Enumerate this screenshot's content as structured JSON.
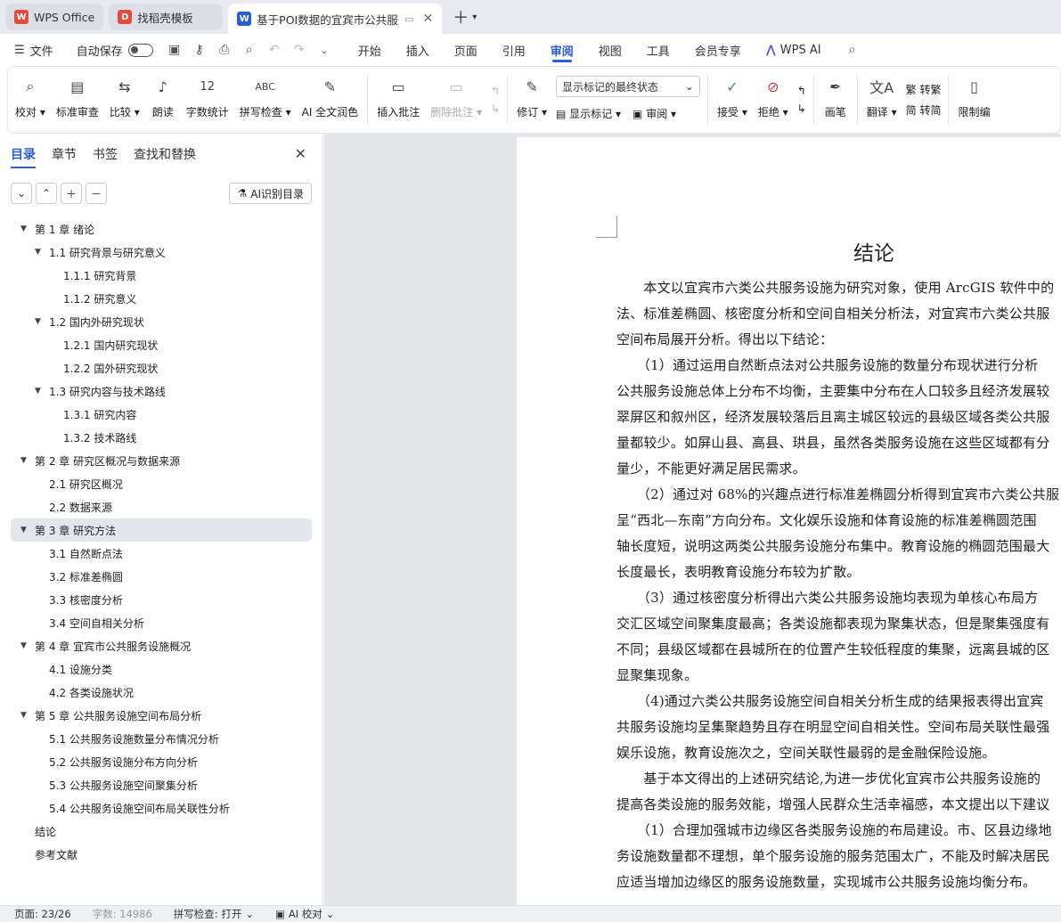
{
  "tabs": [
    {
      "label": "WPS Office",
      "icon": "wps-logo-icon",
      "color": "#e64a3b"
    },
    {
      "label": "找稻壳模板",
      "icon": "docer-logo-icon",
      "color": "#e64a3b"
    },
    {
      "label": "基于POI数据的宜宾市公共服务",
      "icon": "word-doc-icon",
      "color": "#2b5cd9",
      "active": true
    }
  ],
  "menubar": {
    "file": "文件",
    "autosave": "自动保存",
    "tabs": [
      "开始",
      "插入",
      "页面",
      "引用",
      "审阅",
      "视图",
      "工具",
      "会员专享"
    ],
    "active_tab": "审阅",
    "ai_label": "WPS AI"
  },
  "ribbon": {
    "proofread": "校对",
    "standard_review": "标准审查",
    "compare": "比较",
    "read_aloud": "朗读",
    "word_count": "字数统计",
    "spell_check": "拼写检查",
    "ai_polish": "AI 全文润色",
    "insert_comment": "插入批注",
    "delete_comment": "删除批注",
    "track_changes": "修订",
    "markup_dropdown": "显示标记的最终状态",
    "show_markup": "显示标记",
    "review": "审阅",
    "accept": "接受",
    "reject": "拒绝",
    "pen": "画笔",
    "translate": "翻译",
    "to_traditional": "转繁",
    "to_simplified": "转简",
    "restrict": "限制编"
  },
  "sidebar": {
    "tabs": [
      "目录",
      "章节",
      "书签",
      "查找和替换"
    ],
    "ai_toc": "AI识别目录",
    "toc": [
      {
        "text": "第 1 章  绪论",
        "level": 0,
        "arrow": true
      },
      {
        "text": "1.1  研究背景与研究意义",
        "level": 1,
        "arrow": true
      },
      {
        "text": "1.1.1  研究背景",
        "level": 2
      },
      {
        "text": "1.1.2  研究意义",
        "level": 2
      },
      {
        "text": "1.2  国内外研究现状",
        "level": 1,
        "arrow": true
      },
      {
        "text": "1.2.1  国内研究现状",
        "level": 2
      },
      {
        "text": "1.2.2  国外研究现状",
        "level": 2
      },
      {
        "text": "1.3  研究内容与技术路线",
        "level": 1,
        "arrow": true
      },
      {
        "text": "1.3.1  研究内容",
        "level": 2
      },
      {
        "text": "1.3.2  技术路线",
        "level": 2
      },
      {
        "text": "第 2 章  研究区概况与数据来源",
        "level": 0,
        "arrow": true
      },
      {
        "text": "2.1  研究区概况",
        "level": 1
      },
      {
        "text": "2.2  数据来源",
        "level": 1
      },
      {
        "text": "第 3 章  研究方法",
        "level": 0,
        "arrow": true,
        "selected": true
      },
      {
        "text": "3.1  自然断点法",
        "level": 1
      },
      {
        "text": "3.2  标准差椭圆",
        "level": 1
      },
      {
        "text": "3.3  核密度分析",
        "level": 1
      },
      {
        "text": "3.4  空间自相关分析",
        "level": 1
      },
      {
        "text": "第 4 章  宜宾市公共服务设施概况",
        "level": 0,
        "arrow": true
      },
      {
        "text": "4.1  设施分类",
        "level": 1
      },
      {
        "text": "4.2  各类设施状况",
        "level": 1
      },
      {
        "text": "第 5 章  公共服务设施空间布局分析",
        "level": 0,
        "arrow": true
      },
      {
        "text": "5.1  公共服务设施数量分布情况分析",
        "level": 1
      },
      {
        "text": "5.2  公共服务设施分布方向分析",
        "level": 1
      },
      {
        "text": "5.3  公共服务设施空间聚集分析",
        "level": 1
      },
      {
        "text": "5.4  公共服务设施空间布局关联性分析",
        "level": 1
      },
      {
        "text": "结论",
        "level": 0
      },
      {
        "text": "参考文献",
        "level": 0
      }
    ]
  },
  "document": {
    "title": "结论",
    "lines": [
      "　　本文以宜宾市六类公共服务设施为研究对象，使用 ArcGIS 软件中的",
      "法、标准差椭圆、核密度分析和空间自相关分析法，对宜宾市六类公共服",
      "空间布局展开分析。得出以下结论：",
      "　　（1）通过运用自然断点法对公共服务设施的数量分布现状进行分析",
      "公共服务设施总体上分布不均衡，主要集中分布在人口较多且经济发展较",
      "翠屏区和叙州区，经济发展较落后且离主城区较远的县级区域各类公共服",
      "量都较少。如屏山县、高县、珙县，虽然各类服务设施在这些区域都有分",
      "量少，不能更好满足居民需求。",
      "　　（2）通过对 68%的兴趣点进行标准差椭圆分析得到宜宾市六类公共服",
      "呈“西北—东南”方向分布。文化娱乐设施和体育设施的标准差椭圆范围",
      "轴长度短，说明这两类公共服务设施分布集中。教育设施的椭圆范围最大",
      "长度最长，表明教育设施分布较为扩散。",
      "　　（3）通过核密度分析得出六类公共服务设施均表现为单核心布局方",
      "交汇区域空间聚集度最高；各类设施都表现为聚集状态，但是聚集强度有",
      "不同；县级区域都在县城所在的位置产生较低程度的集聚，远离县城的区",
      "显聚集现象。",
      "　　（4)通过六类公共服务设施空间自相关分析生成的结果报表得出宜宾",
      "共服务设施均呈集聚趋势且存在明显空间自相关性。空间布局关联性最强",
      "娱乐设施，教育设施次之，空间关联性最弱的是金融保险设施。",
      "　　基于本文得出的上述研究结论,为进一步优化宜宾市公共服务设施的",
      "提高各类设施的服务效能，增强人民群众生活幸福感，本文提出以下建议",
      "　　（1）合理加强城市边缘区各类服务设施的布局建设。市、区县边缘地",
      "务设施数量都不理想，单个服务设施的服务范围太广，不能及时解决居民",
      "应适当增加边缘区的服务设施数量，实现城市公共服务设施均衡分布。"
    ]
  },
  "status": {
    "page": "页面: 23/26",
    "words": "字数: 14986",
    "spell": "拼写检查: 打开",
    "ai_proof": "AI 校对"
  }
}
